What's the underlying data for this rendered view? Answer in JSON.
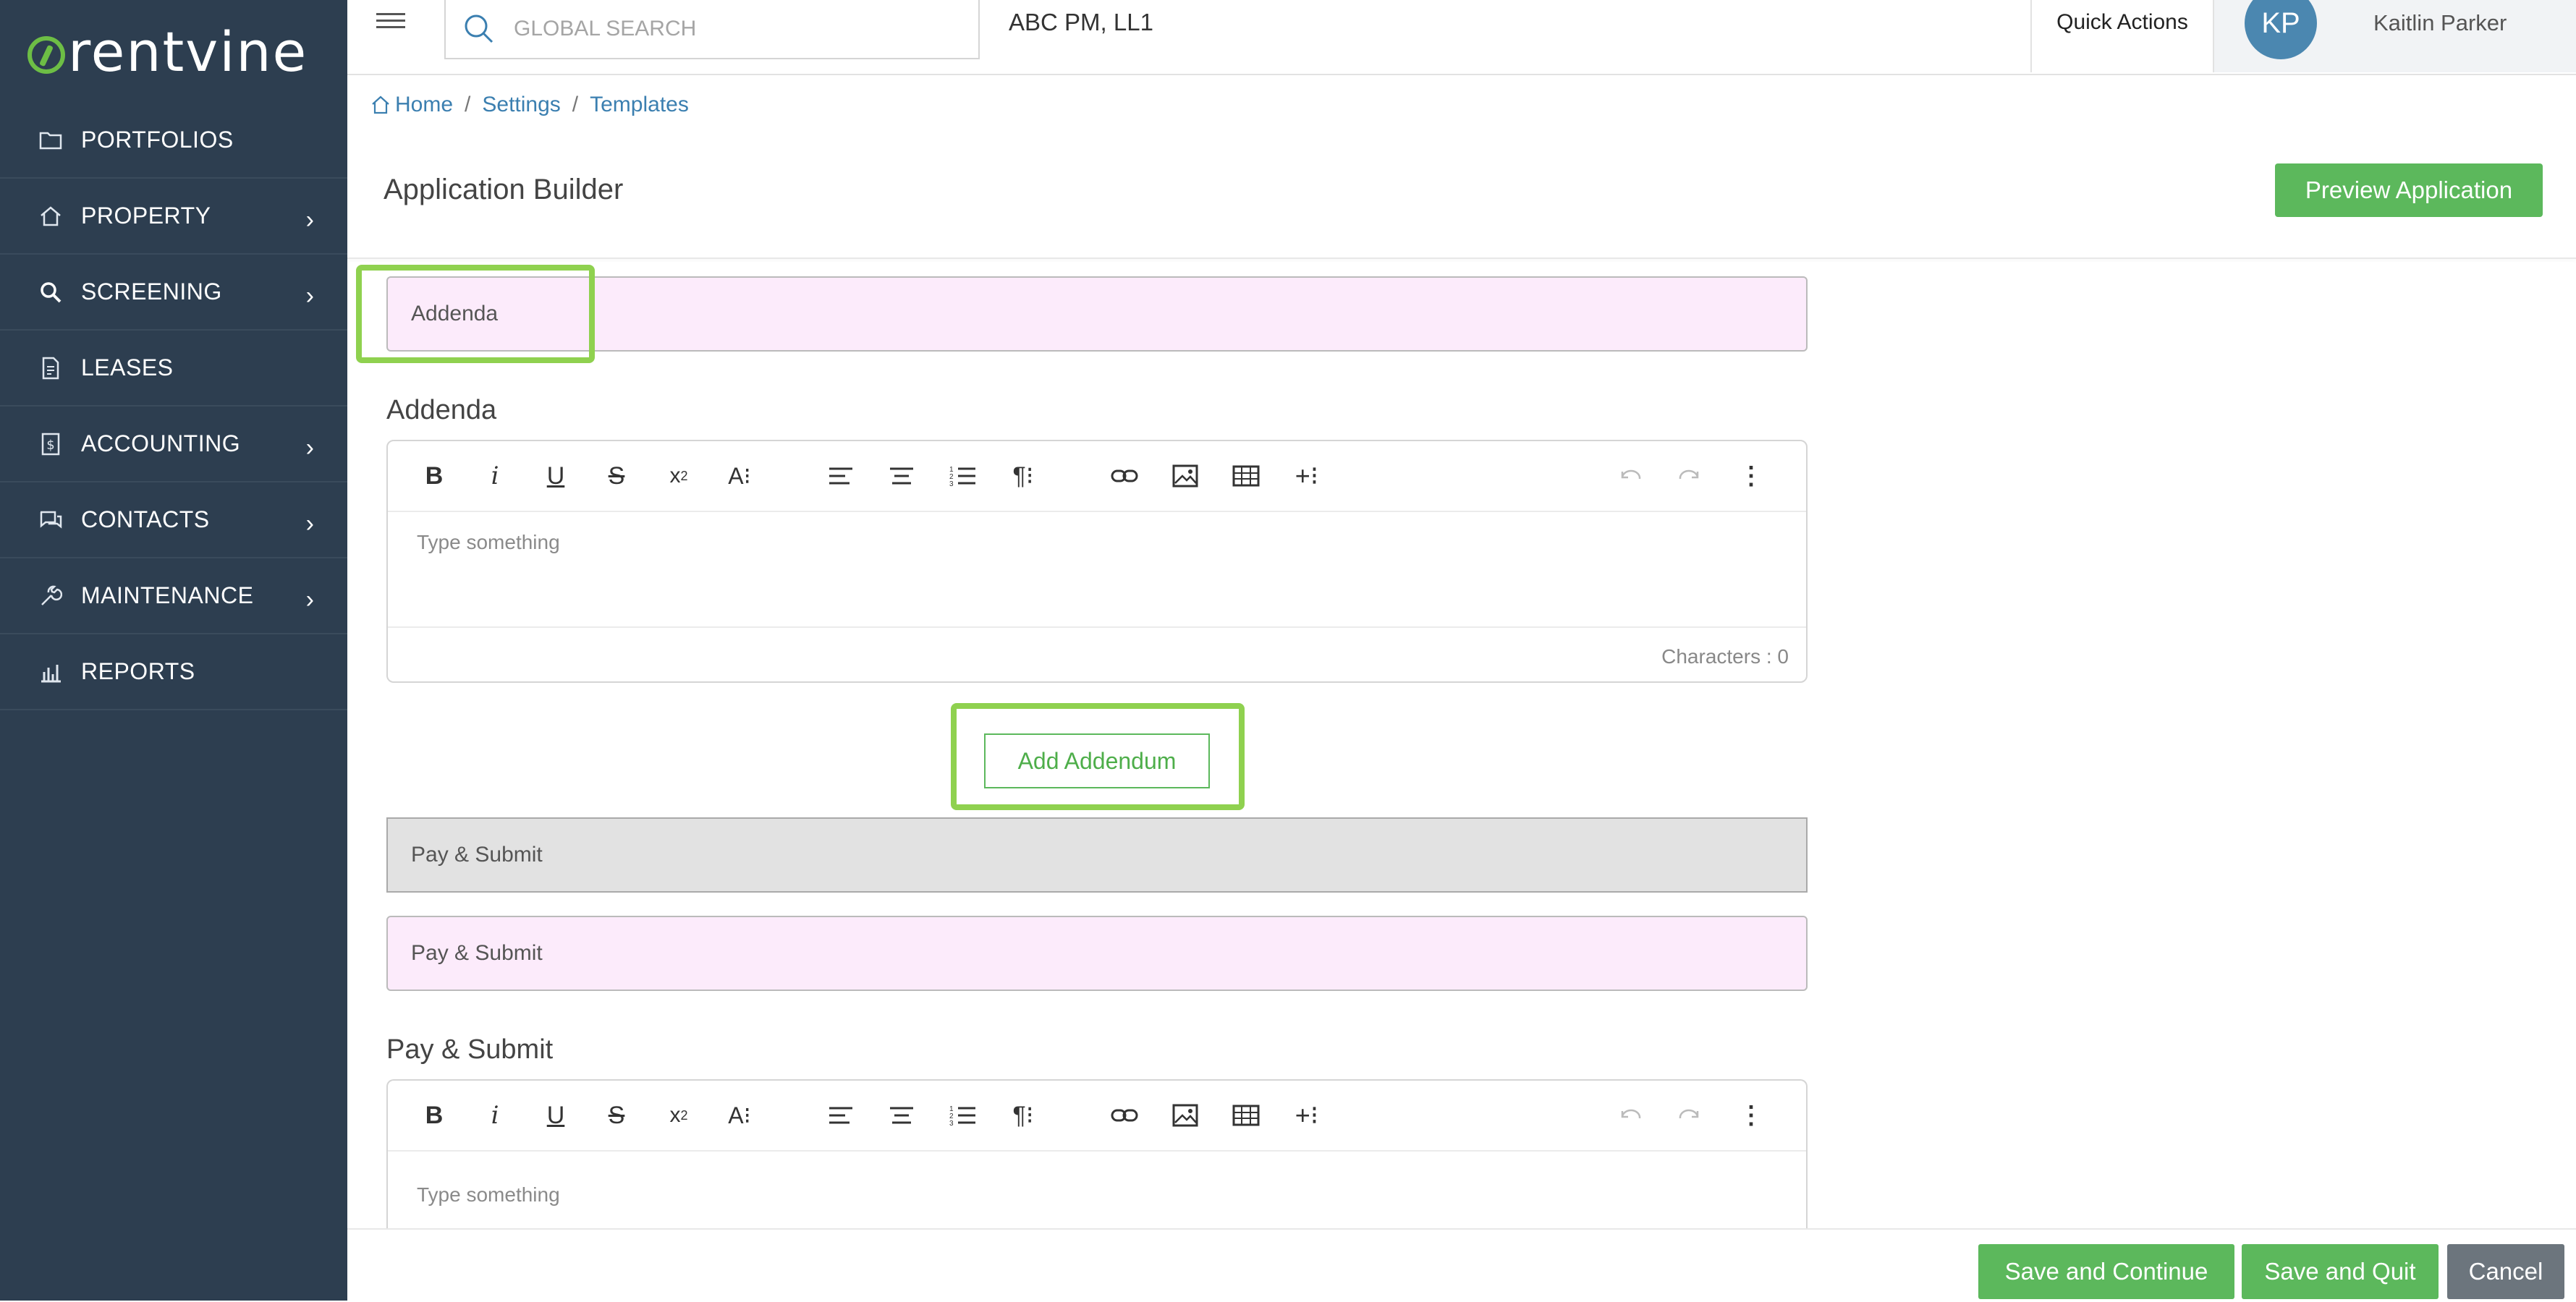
{
  "brand": {
    "name": "rentvine",
    "accent": "#6dbe45",
    "sidebar_bg": "#2d3e50"
  },
  "sidebar": {
    "items": [
      {
        "label": "PORTFOLIOS",
        "icon": "folder-icon",
        "has_submenu": false
      },
      {
        "label": "PROPERTY",
        "icon": "home-icon",
        "has_submenu": true
      },
      {
        "label": "SCREENING",
        "icon": "magnifier-icon",
        "has_submenu": true
      },
      {
        "label": "LEASES",
        "icon": "document-icon",
        "has_submenu": false
      },
      {
        "label": "ACCOUNTING",
        "icon": "dollar-icon",
        "has_submenu": true
      },
      {
        "label": "CONTACTS",
        "icon": "chat-icon",
        "has_submenu": true
      },
      {
        "label": "MAINTENANCE",
        "icon": "wrench-icon",
        "has_submenu": true
      },
      {
        "label": "REPORTS",
        "icon": "chart-icon",
        "has_submenu": false
      }
    ]
  },
  "header": {
    "search_placeholder": "GLOBAL SEARCH",
    "company": "ABC PM, LL1",
    "quick_actions": "Quick Actions",
    "user_initials": "KP",
    "user_name": "Kaitlin Parker"
  },
  "breadcrumb": {
    "home": "Home",
    "settings": "Settings",
    "templates": "Templates"
  },
  "page": {
    "title": "Application Builder",
    "preview_button": "Preview Application"
  },
  "sections": {
    "addenda_field": "Addenda",
    "addenda_heading": "Addenda",
    "addenda_editor": {
      "placeholder": "Type something",
      "char_count": "Characters : 0"
    },
    "add_addendum": "Add Addendum",
    "pay_submit_grey": "Pay & Submit",
    "pay_submit_field": "Pay & Submit",
    "pay_submit_heading": "Pay & Submit",
    "pay_submit_editor": {
      "placeholder": "Type something"
    }
  },
  "toolbar_icons": [
    "bold-icon",
    "italic-icon",
    "underline-icon",
    "strikethrough-icon",
    "subscript-icon",
    "font-size-icon",
    "align-left-icon",
    "align-center-icon",
    "ordered-list-icon",
    "paragraph-icon",
    "link-icon",
    "image-icon",
    "table-icon",
    "insert-more-icon",
    "undo-icon",
    "redo-icon",
    "more-vertical-icon"
  ],
  "footer": {
    "save_continue": "Save and Continue",
    "save_quit": "Save and Quit",
    "cancel": "Cancel"
  }
}
